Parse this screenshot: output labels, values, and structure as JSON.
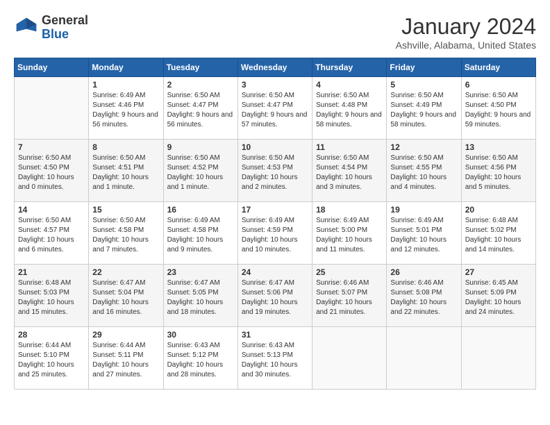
{
  "header": {
    "logo": {
      "general": "General",
      "blue": "Blue"
    },
    "title": "January 2024",
    "subtitle": "Ashville, Alabama, United States"
  },
  "calendar": {
    "days_of_week": [
      "Sunday",
      "Monday",
      "Tuesday",
      "Wednesday",
      "Thursday",
      "Friday",
      "Saturday"
    ],
    "weeks": [
      [
        {
          "day": "",
          "sunrise": "",
          "sunset": "",
          "daylight": "",
          "empty": true
        },
        {
          "day": "1",
          "sunrise": "Sunrise: 6:49 AM",
          "sunset": "Sunset: 4:46 PM",
          "daylight": "Daylight: 9 hours and 56 minutes."
        },
        {
          "day": "2",
          "sunrise": "Sunrise: 6:50 AM",
          "sunset": "Sunset: 4:47 PM",
          "daylight": "Daylight: 9 hours and 56 minutes."
        },
        {
          "day": "3",
          "sunrise": "Sunrise: 6:50 AM",
          "sunset": "Sunset: 4:47 PM",
          "daylight": "Daylight: 9 hours and 57 minutes."
        },
        {
          "day": "4",
          "sunrise": "Sunrise: 6:50 AM",
          "sunset": "Sunset: 4:48 PM",
          "daylight": "Daylight: 9 hours and 58 minutes."
        },
        {
          "day": "5",
          "sunrise": "Sunrise: 6:50 AM",
          "sunset": "Sunset: 4:49 PM",
          "daylight": "Daylight: 9 hours and 58 minutes."
        },
        {
          "day": "6",
          "sunrise": "Sunrise: 6:50 AM",
          "sunset": "Sunset: 4:50 PM",
          "daylight": "Daylight: 9 hours and 59 minutes."
        }
      ],
      [
        {
          "day": "7",
          "sunrise": "Sunrise: 6:50 AM",
          "sunset": "Sunset: 4:50 PM",
          "daylight": "Daylight: 10 hours and 0 minutes."
        },
        {
          "day": "8",
          "sunrise": "Sunrise: 6:50 AM",
          "sunset": "Sunset: 4:51 PM",
          "daylight": "Daylight: 10 hours and 1 minute."
        },
        {
          "day": "9",
          "sunrise": "Sunrise: 6:50 AM",
          "sunset": "Sunset: 4:52 PM",
          "daylight": "Daylight: 10 hours and 1 minute."
        },
        {
          "day": "10",
          "sunrise": "Sunrise: 6:50 AM",
          "sunset": "Sunset: 4:53 PM",
          "daylight": "Daylight: 10 hours and 2 minutes."
        },
        {
          "day": "11",
          "sunrise": "Sunrise: 6:50 AM",
          "sunset": "Sunset: 4:54 PM",
          "daylight": "Daylight: 10 hours and 3 minutes."
        },
        {
          "day": "12",
          "sunrise": "Sunrise: 6:50 AM",
          "sunset": "Sunset: 4:55 PM",
          "daylight": "Daylight: 10 hours and 4 minutes."
        },
        {
          "day": "13",
          "sunrise": "Sunrise: 6:50 AM",
          "sunset": "Sunset: 4:56 PM",
          "daylight": "Daylight: 10 hours and 5 minutes."
        }
      ],
      [
        {
          "day": "14",
          "sunrise": "Sunrise: 6:50 AM",
          "sunset": "Sunset: 4:57 PM",
          "daylight": "Daylight: 10 hours and 6 minutes."
        },
        {
          "day": "15",
          "sunrise": "Sunrise: 6:50 AM",
          "sunset": "Sunset: 4:58 PM",
          "daylight": "Daylight: 10 hours and 7 minutes."
        },
        {
          "day": "16",
          "sunrise": "Sunrise: 6:49 AM",
          "sunset": "Sunset: 4:58 PM",
          "daylight": "Daylight: 10 hours and 9 minutes."
        },
        {
          "day": "17",
          "sunrise": "Sunrise: 6:49 AM",
          "sunset": "Sunset: 4:59 PM",
          "daylight": "Daylight: 10 hours and 10 minutes."
        },
        {
          "day": "18",
          "sunrise": "Sunrise: 6:49 AM",
          "sunset": "Sunset: 5:00 PM",
          "daylight": "Daylight: 10 hours and 11 minutes."
        },
        {
          "day": "19",
          "sunrise": "Sunrise: 6:49 AM",
          "sunset": "Sunset: 5:01 PM",
          "daylight": "Daylight: 10 hours and 12 minutes."
        },
        {
          "day": "20",
          "sunrise": "Sunrise: 6:48 AM",
          "sunset": "Sunset: 5:02 PM",
          "daylight": "Daylight: 10 hours and 14 minutes."
        }
      ],
      [
        {
          "day": "21",
          "sunrise": "Sunrise: 6:48 AM",
          "sunset": "Sunset: 5:03 PM",
          "daylight": "Daylight: 10 hours and 15 minutes."
        },
        {
          "day": "22",
          "sunrise": "Sunrise: 6:47 AM",
          "sunset": "Sunset: 5:04 PM",
          "daylight": "Daylight: 10 hours and 16 minutes."
        },
        {
          "day": "23",
          "sunrise": "Sunrise: 6:47 AM",
          "sunset": "Sunset: 5:05 PM",
          "daylight": "Daylight: 10 hours and 18 minutes."
        },
        {
          "day": "24",
          "sunrise": "Sunrise: 6:47 AM",
          "sunset": "Sunset: 5:06 PM",
          "daylight": "Daylight: 10 hours and 19 minutes."
        },
        {
          "day": "25",
          "sunrise": "Sunrise: 6:46 AM",
          "sunset": "Sunset: 5:07 PM",
          "daylight": "Daylight: 10 hours and 21 minutes."
        },
        {
          "day": "26",
          "sunrise": "Sunrise: 6:46 AM",
          "sunset": "Sunset: 5:08 PM",
          "daylight": "Daylight: 10 hours and 22 minutes."
        },
        {
          "day": "27",
          "sunrise": "Sunrise: 6:45 AM",
          "sunset": "Sunset: 5:09 PM",
          "daylight": "Daylight: 10 hours and 24 minutes."
        }
      ],
      [
        {
          "day": "28",
          "sunrise": "Sunrise: 6:44 AM",
          "sunset": "Sunset: 5:10 PM",
          "daylight": "Daylight: 10 hours and 25 minutes."
        },
        {
          "day": "29",
          "sunrise": "Sunrise: 6:44 AM",
          "sunset": "Sunset: 5:11 PM",
          "daylight": "Daylight: 10 hours and 27 minutes."
        },
        {
          "day": "30",
          "sunrise": "Sunrise: 6:43 AM",
          "sunset": "Sunset: 5:12 PM",
          "daylight": "Daylight: 10 hours and 28 minutes."
        },
        {
          "day": "31",
          "sunrise": "Sunrise: 6:43 AM",
          "sunset": "Sunset: 5:13 PM",
          "daylight": "Daylight: 10 hours and 30 minutes."
        },
        {
          "day": "",
          "sunrise": "",
          "sunset": "",
          "daylight": "",
          "empty": true
        },
        {
          "day": "",
          "sunrise": "",
          "sunset": "",
          "daylight": "",
          "empty": true
        },
        {
          "day": "",
          "sunrise": "",
          "sunset": "",
          "daylight": "",
          "empty": true
        }
      ]
    ]
  }
}
